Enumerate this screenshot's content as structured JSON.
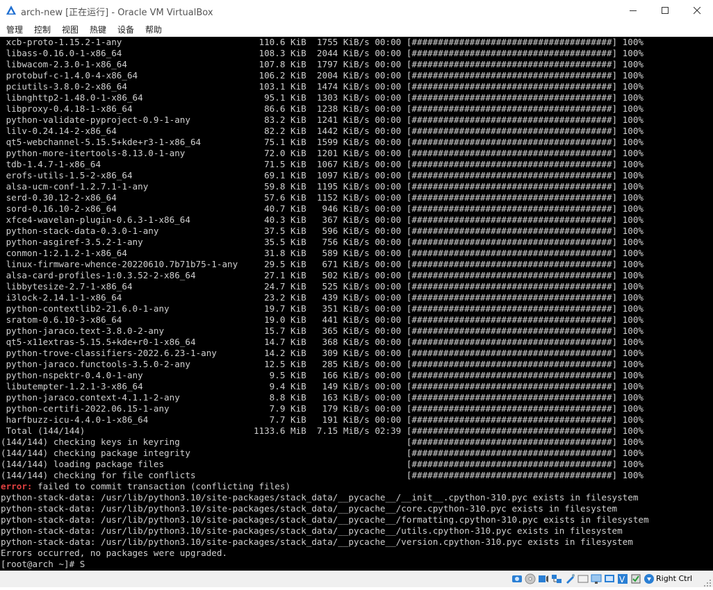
{
  "window": {
    "title": "arch-new [正在运行] - Oracle VM VirtualBox"
  },
  "menu": [
    "管理",
    "控制",
    "视图",
    "热键",
    "设备",
    "帮助"
  ],
  "terminal": {
    "lines": [
      " xcb-proto-1.15.2-1-any                          110.6 KiB  1755 KiB/s 00:00 [######################################] 100%",
      " libass-0.16.0-1-x86_64                          108.3 KiB  2044 KiB/s 00:00 [######################################] 100%",
      " libwacom-2.3.0-1-x86_64                         107.8 KiB  1797 KiB/s 00:00 [######################################] 100%",
      " protobuf-c-1.4.0-4-x86_64                       106.2 KiB  2004 KiB/s 00:00 [######################################] 100%",
      " pciutils-3.8.0-2-x86_64                         103.1 KiB  1474 KiB/s 00:00 [######################################] 100%",
      " libnghttp2-1.48.0-1-x86_64                       95.1 KiB  1303 KiB/s 00:00 [######################################] 100%",
      " libproxy-0.4.18-1-x86_64                         86.6 KiB  1238 KiB/s 00:00 [######################################] 100%",
      " python-validate-pyproject-0.9-1-any              83.2 KiB  1241 KiB/s 00:00 [######################################] 100%",
      " lilv-0.24.14-2-x86_64                            82.2 KiB  1442 KiB/s 00:00 [######################################] 100%",
      " qt5-webchannel-5.15.5+kde+r3-1-x86_64            75.1 KiB  1599 KiB/s 00:00 [######################################] 100%",
      " python-more-itertools-8.13.0-1-any               72.0 KiB  1201 KiB/s 00:00 [######################################] 100%",
      " tdb-1.4.7-1-x86_64                               71.5 KiB  1067 KiB/s 00:00 [######################################] 100%",
      " erofs-utils-1.5-2-x86_64                         69.1 KiB  1097 KiB/s 00:00 [######################################] 100%",
      " alsa-ucm-conf-1.2.7.1-1-any                      59.8 KiB  1195 KiB/s 00:00 [######################################] 100%",
      " serd-0.30.12-2-x86_64                            57.6 KiB  1152 KiB/s 00:00 [######################################] 100%",
      " sord-0.16.10-2-x86_64                            40.7 KiB   946 KiB/s 00:00 [######################################] 100%",
      " xfce4-wavelan-plugin-0.6.3-1-x86_64              40.3 KiB   367 KiB/s 00:00 [######################################] 100%",
      " python-stack-data-0.3.0-1-any                    37.5 KiB   596 KiB/s 00:00 [######################################] 100%",
      " python-asgiref-3.5.2-1-any                       35.5 KiB   756 KiB/s 00:00 [######################################] 100%",
      " conmon-1:2.1.2-1-x86_64                          31.8 KiB   589 KiB/s 00:00 [######################################] 100%",
      " linux-firmware-whence-20220610.7b71b75-1-any     29.5 KiB   671 KiB/s 00:00 [######################################] 100%",
      " alsa-card-profiles-1:0.3.52-2-x86_64             27.1 KiB   502 KiB/s 00:00 [######################################] 100%",
      " libbytesize-2.7-1-x86_64                         24.7 KiB   525 KiB/s 00:00 [######################################] 100%",
      " i3lock-2.14.1-1-x86_64                           23.2 KiB   439 KiB/s 00:00 [######################################] 100%",
      " python-contextlib2-21.6.0-1-any                  19.7 KiB   351 KiB/s 00:00 [######################################] 100%",
      " sratom-0.6.10-3-x86_64                           19.0 KiB   441 KiB/s 00:00 [######################################] 100%",
      " python-jaraco.text-3.8.0-2-any                   15.7 KiB   365 KiB/s 00:00 [######################################] 100%",
      " qt5-x11extras-5.15.5+kde+r0-1-x86_64             14.7 KiB   368 KiB/s 00:00 [######################################] 100%",
      " python-trove-classifiers-2022.6.23-1-any         14.2 KiB   309 KiB/s 00:00 [######################################] 100%",
      " python-jaraco.functools-3.5.0-2-any              12.5 KiB   285 KiB/s 00:00 [######################################] 100%",
      " python-nspektr-0.4.0-1-any                        9.5 KiB   166 KiB/s 00:00 [######################################] 100%",
      " libutempter-1.2.1-3-x86_64                        9.4 KiB   149 KiB/s 00:00 [######################################] 100%",
      " python-jaraco.context-4.1.1-2-any                 8.8 KiB   163 KiB/s 00:00 [######################################] 100%",
      " python-certifi-2022.06.15-1-any                   7.9 KiB   179 KiB/s 00:00 [######################################] 100%",
      " harfbuzz-icu-4.4.0-1-x86_64                       7.7 KiB   191 KiB/s 00:00 [######################################] 100%",
      " Total (144/144)                                1133.6 MiB  7.15 MiB/s 02:39 [######################################] 100%",
      "(144/144) checking keys in keyring                                           [######################################] 100%",
      "(144/144) checking package integrity                                         [######################################] 100%",
      "(144/144) loading package files                                              [######################################] 100%",
      "(144/144) checking for file conflicts                                        [######################################] 100%"
    ],
    "error_label": "error:",
    "error_message": " failed to commit transaction (conflicting files)",
    "conflict_lines": [
      "python-stack-data: /usr/lib/python3.10/site-packages/stack_data/__pycache__/__init__.cpython-310.pyc exists in filesystem",
      "python-stack-data: /usr/lib/python3.10/site-packages/stack_data/__pycache__/core.cpython-310.pyc exists in filesystem",
      "python-stack-data: /usr/lib/python3.10/site-packages/stack_data/__pycache__/formatting.cpython-310.pyc exists in filesystem",
      "python-stack-data: /usr/lib/python3.10/site-packages/stack_data/__pycache__/utils.cpython-310.pyc exists in filesystem",
      "python-stack-data: /usr/lib/python3.10/site-packages/stack_data/__pycache__/version.cpython-310.pyc exists in filesystem"
    ],
    "summary": "Errors occurred, no packages were upgraded.",
    "prompt": "[root@arch ~]# S"
  },
  "statusbar": {
    "host_key": "Right Ctrl",
    "icons": [
      "hard-disk-icon",
      "optical-drive-icon",
      "audio-icon",
      "network-icon",
      "usb-icon",
      "shared-folders-icon",
      "display-icon",
      "video-capture-icon",
      "virtualization-icon",
      "cpu-icon",
      "mouse-integration-icon",
      "keyboard-icon"
    ]
  },
  "colors": {
    "terminal_bg": "#000000",
    "terminal_fg": "#cfcfcf",
    "error": "#e04040",
    "chrome_bg": "#ffffff",
    "statusbar_bg": "#f0f0f0"
  }
}
